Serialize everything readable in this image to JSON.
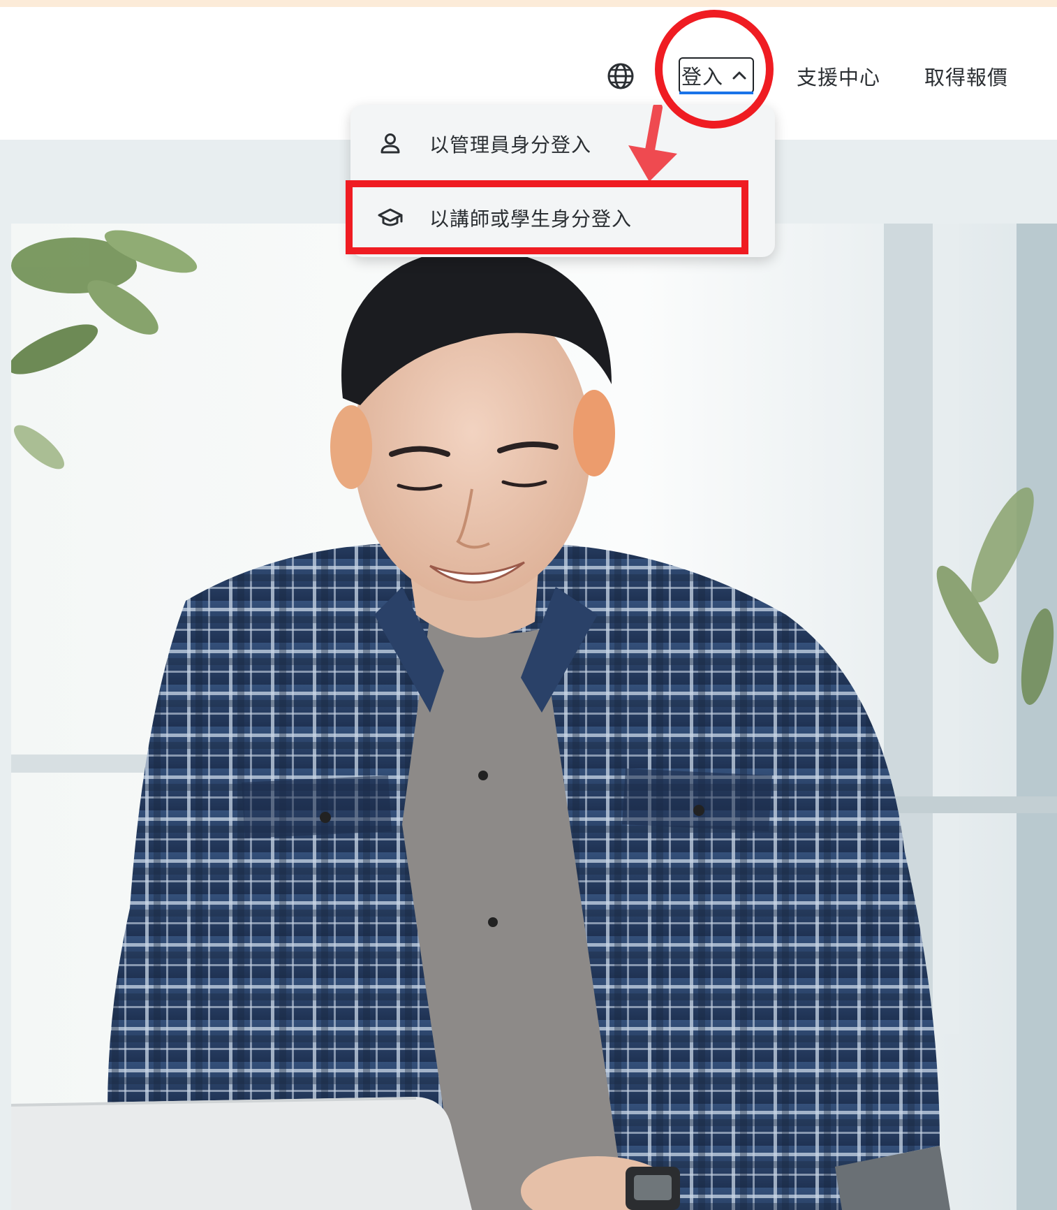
{
  "header": {
    "language_icon": "globe-icon",
    "login": {
      "label": "登入",
      "icon": "chevron-up-icon",
      "expanded": true
    },
    "nav": [
      {
        "label": "支援中心"
      },
      {
        "label": "取得報價"
      }
    ]
  },
  "login_menu": {
    "items": [
      {
        "label": "以管理員身分登入",
        "icon": "person-icon"
      },
      {
        "label": "以講師或學生身分登入",
        "icon": "graduation-cap-icon"
      }
    ]
  },
  "annotations": {
    "highlight_color": "#ef1c22",
    "marks": [
      "circle-highlight",
      "arrow-pointer",
      "rectangle-highlight"
    ]
  },
  "hero": {
    "image": "smiling-man-in-plaid-shirt-using-laptop-photo"
  },
  "colors": {
    "header_background": "#ffffff",
    "top_strip": "#fcebd8",
    "page_background": "#e8eef0",
    "menu_background": "#f3f5f6",
    "text": "#2b2f33",
    "focus_underline": "#1a73e8"
  }
}
